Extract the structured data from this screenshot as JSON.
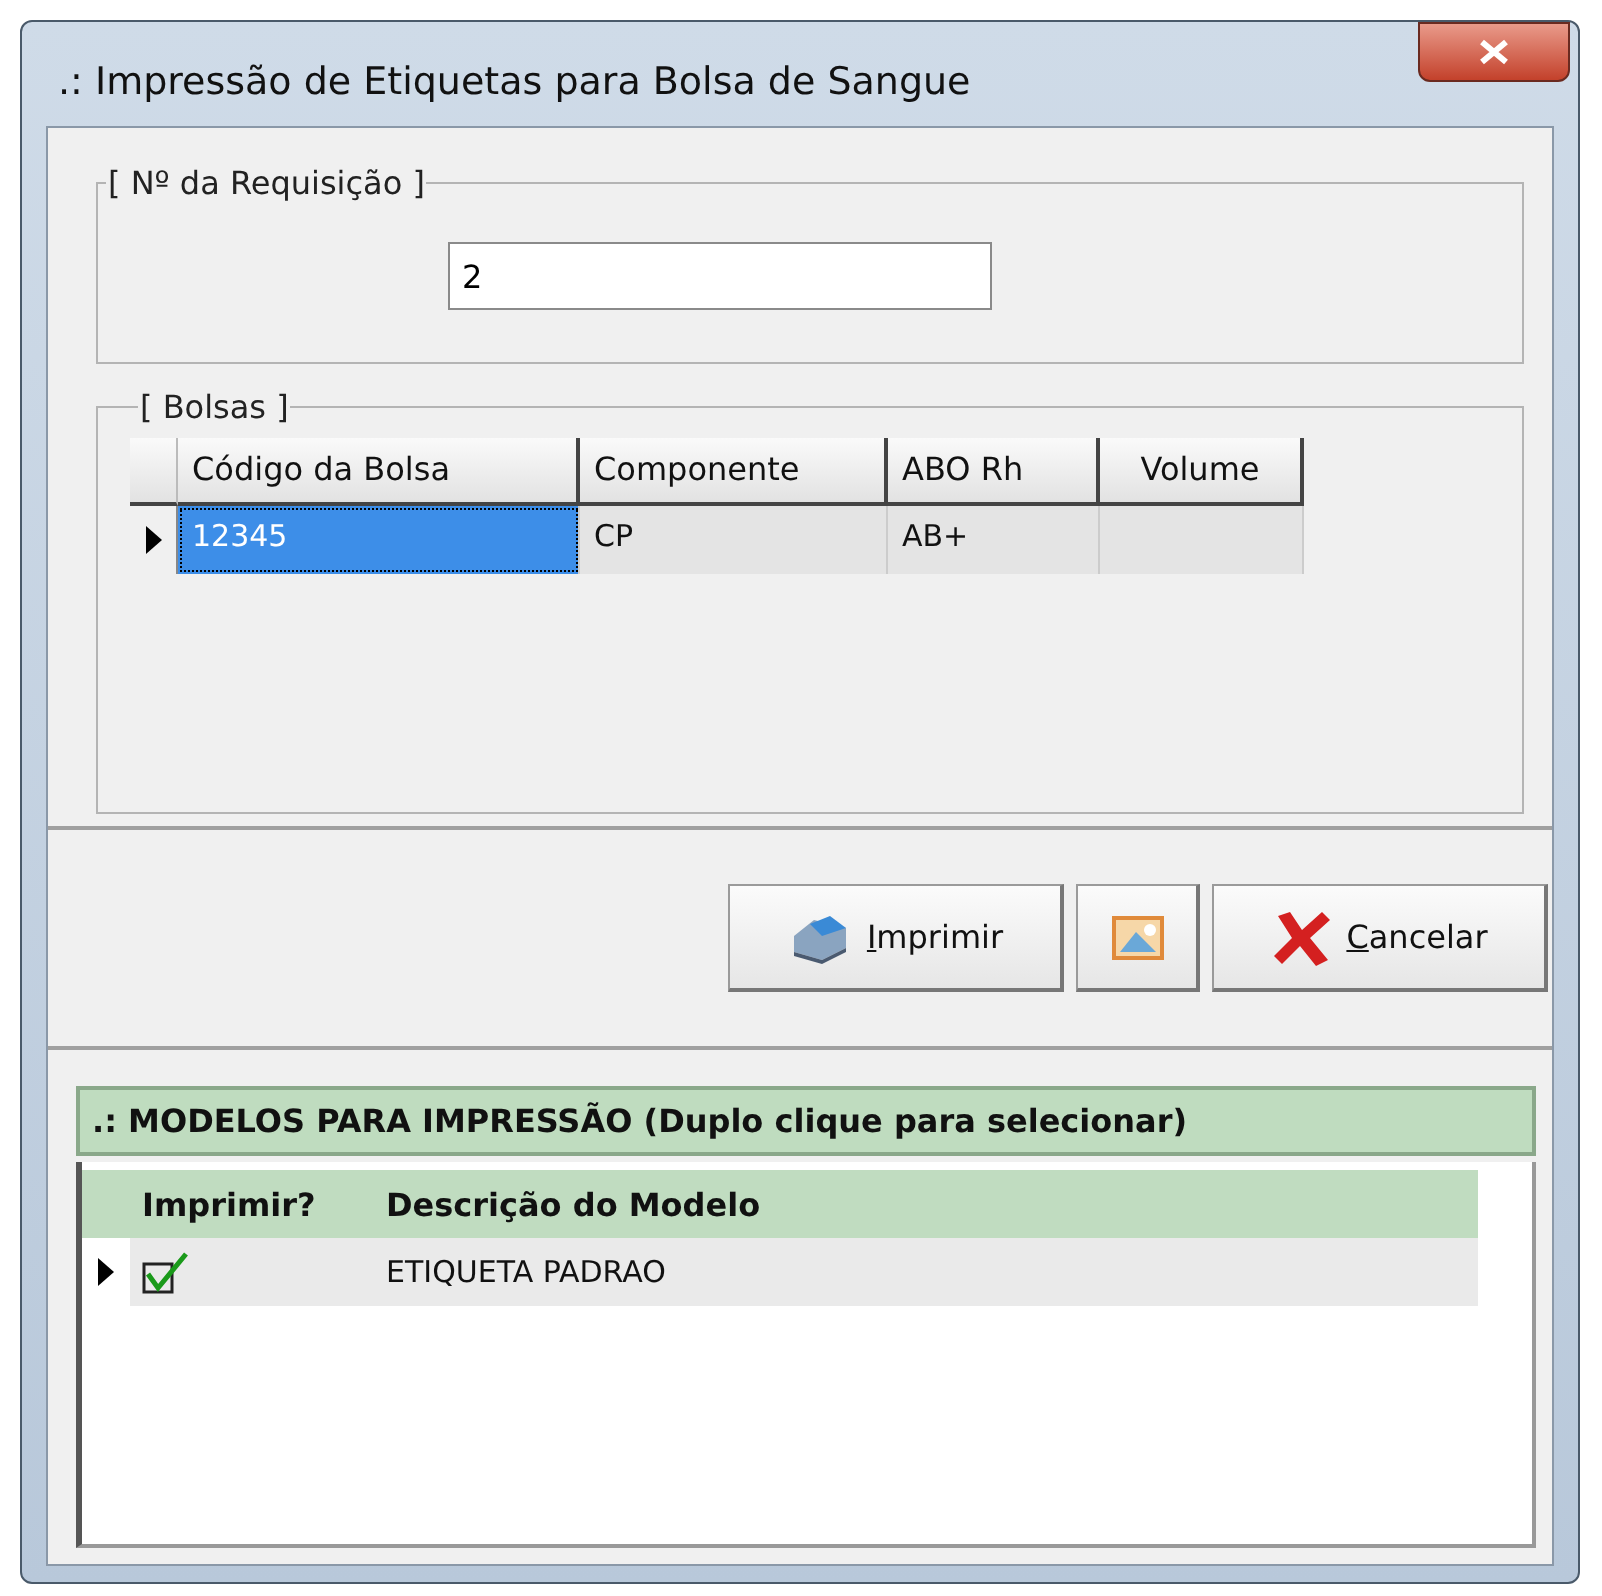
{
  "window": {
    "title": ".: Impressão de Etiquetas para Bolsa de Sangue"
  },
  "requisicao": {
    "legend": "[ Nº da Requisição ]",
    "value": "2"
  },
  "bolsas": {
    "legend": "[ Bolsas ]",
    "columns": [
      "Código da Bolsa",
      "Componente",
      "ABO Rh",
      "Volume"
    ],
    "rows": [
      {
        "selected": true,
        "cells": [
          "12345",
          "CP",
          "AB+",
          ""
        ]
      }
    ]
  },
  "buttons": [
    {
      "kind": "print",
      "label": "Imprimir"
    },
    {
      "kind": "picture"
    },
    {
      "kind": "cancel",
      "label": "Cancelar"
    }
  ],
  "modelos": {
    "title": ".: MODELOS PARA IMPRESSÃO  (Duplo clique para selecionar)",
    "columns": [
      "Imprimir?",
      "Descrição do Modelo"
    ],
    "rows": [
      {
        "selected": true,
        "checked": true,
        "description": "ETIQUETA PADRAO"
      }
    ]
  }
}
